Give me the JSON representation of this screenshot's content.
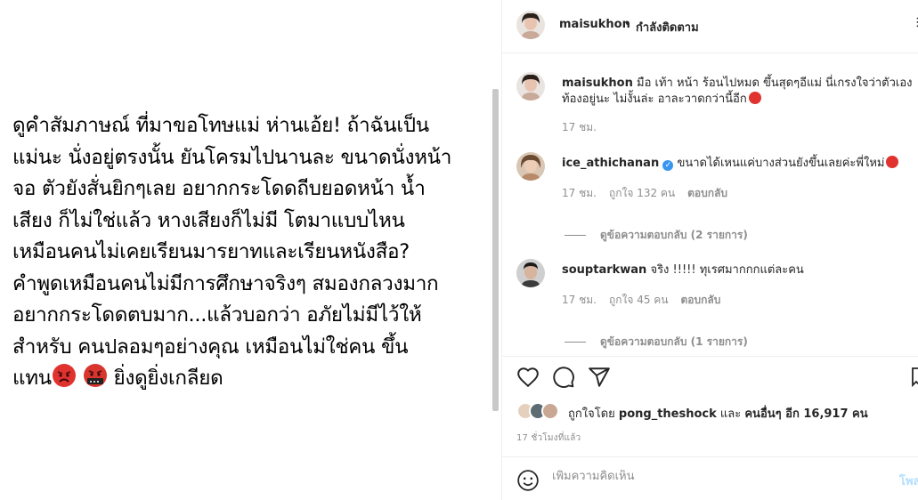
{
  "post": {
    "caption_lines": [
      "ดูคำสัมภาษณ์ ที่มาขอโทษแม่ ห่านเอ้ย! ถ้าฉันเป็น",
      "แม่นะ นั่งอยู่ตรงนั้น ยันโครมไปนานละ ขนาดนั่งหน้า",
      "จอ ตัวยังสั่นยิกๆเลย อยากกระโดดถีบยอดหน้า น้ำ",
      "เสียง ก็ไม่ใช่แล้ว หางเสียงก็ไม่มี โตมาแบบไหน",
      "เหมือนคนไม่เคยเรียนมารยาทและเรียนหนังสือ?",
      "คำพูดเหมือนคนไม่มีการศึกษาจริงๆ สมองกลวงมาก",
      "อยากกระโดดตบมาก...แล้วบอกว่า อภัยไม่มีไว้ให้",
      "สำหรับ คนปลอมๆอย่างคุณ เหมือนไม่ใช่คน ขึ้น"
    ],
    "last_line_start": "แทน",
    "last_line_end": " ยิ่งดูยิ่งเกลียด",
    "emoji_1": "angry-face",
    "emoji_2": "cursing-face"
  },
  "header": {
    "username": "maisukhon",
    "dot": "•",
    "follow_status": "กำลังติดตาม"
  },
  "caption_comment": {
    "username": "maisukhon",
    "text": "มือ เท้า หน้า ร้อนไปหมด ขึ้นสุดๆอีแม่ นี่เกรงใจว่าตัวเองท้องอยู่นะ ไม่งั้นล่ะ อาละวาดกว่านี้อีก",
    "time": "17 ชม."
  },
  "comments": [
    {
      "username": "ice_athichanan",
      "verified": true,
      "text": "ขนาดได้เหนแค่บางส่วนยังขึ้นเลยค่ะพี่ใหม่",
      "time": "17 ชม.",
      "likes": "ถูกใจ 132 คน",
      "reply": "ตอบกลับ",
      "view_replies": "ดูข้อความตอบกลับ (2 รายการ)"
    },
    {
      "username": "souptarkwan",
      "verified": false,
      "text": "จริง !!!!! ทุเรศมากกกแต่ละคน",
      "time": "17 ชม.",
      "likes": "ถูกใจ 45 คน",
      "reply": "ตอบกลับ",
      "view_replies": "ดูข้อความตอบกลับ (1 รายการ)"
    }
  ],
  "likes": {
    "prefix": "ถูกใจโดย",
    "user": "pong_theshock",
    "and": "และ",
    "others": "คนอื่นๆ อีก 16,917 คน"
  },
  "timestamp": "17 ชั่วโมงที่แล้ว",
  "add_comment": {
    "placeholder": "เพิ่มความคิดเห็น",
    "post_label": "โพสต์"
  },
  "colors": {
    "accent_blue": "#3897f0",
    "angry_red": "#e0332f",
    "muted_text": "#8e8e8e"
  }
}
